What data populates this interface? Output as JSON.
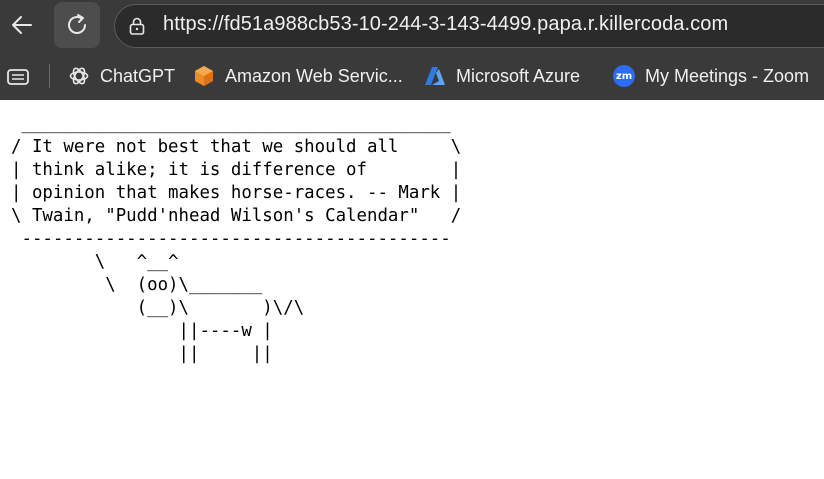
{
  "browser": {
    "url": "https://fd51a988cb53-10-244-3-143-4499.papa.r.killercoda.com",
    "bookmarks": [
      {
        "label": "ChatGPT",
        "icon": "chatgpt-icon"
      },
      {
        "label": "Amazon Web Servic...",
        "icon": "aws-icon"
      },
      {
        "label": "Microsoft Azure",
        "icon": "azure-icon"
      },
      {
        "label": "My Meetings - Zoom",
        "icon": "zoom-icon",
        "badge": "zm"
      }
    ],
    "colors": {
      "chrome": "#3a3a3a",
      "address_bar": "#2b2b2b",
      "aws": "#f08a24",
      "azure": "#2f7bdc",
      "zoom": "#2d6cf6"
    }
  },
  "page": {
    "cowsay": " _________________________________________\n/ It were not best that we should all     \\\n| think alike; it is difference of        |\n| opinion that makes horse-races. -- Mark |\n\\ Twain, \"Pudd'nhead Wilson's Calendar\"   /\n -----------------------------------------\n        \\   ^__^\n         \\  (oo)\\_______\n            (__)\\       )\\/\\\n                ||----w |\n                ||     ||"
  }
}
